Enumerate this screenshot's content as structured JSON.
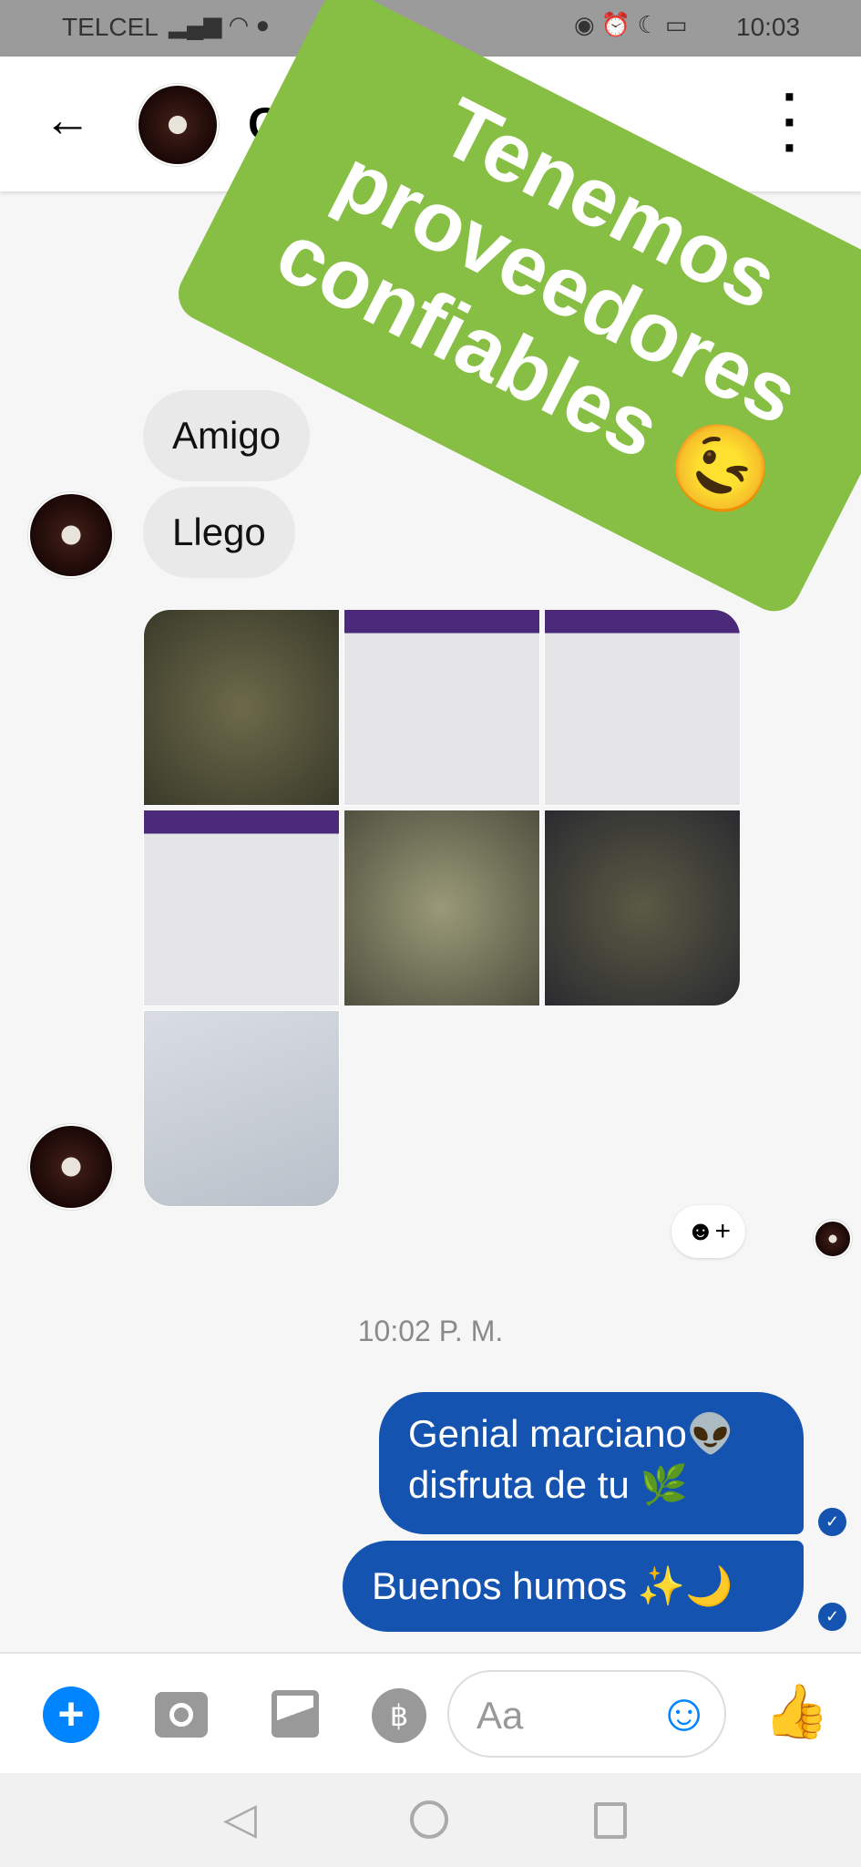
{
  "status_bar": {
    "carrier": "TELCEL",
    "time": "10:03"
  },
  "header": {
    "contact_initial": "C"
  },
  "banner": {
    "lines": [
      "Tenemos",
      "proveedores",
      "confiables 😉"
    ]
  },
  "messages_in": [
    "Amigo",
    "Llego"
  ],
  "timestamp": "10:02 P. M.",
  "messages_out": [
    {
      "lines": [
        "Genial marciano👽",
        "disfruta de tu 🌿"
      ]
    },
    {
      "lines": [
        "Buenos humos ✨🌙"
      ]
    }
  ],
  "compose": {
    "placeholder": "Aa"
  },
  "colors": {
    "accent": "#0084ff",
    "bubble_out": "#1553b0",
    "banner": "#86bf43"
  }
}
